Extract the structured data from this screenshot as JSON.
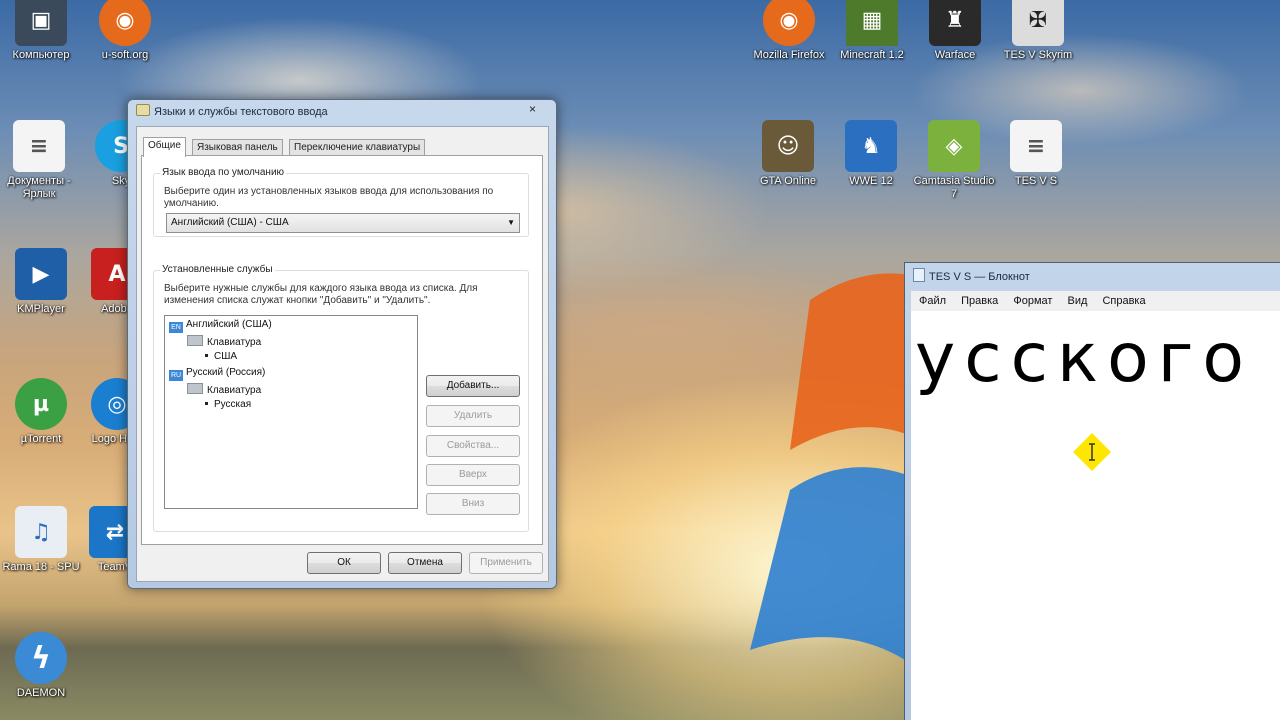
{
  "desktop": {
    "icons": [
      {
        "id": "computer",
        "label": "Компьютер",
        "icon": "computer-icon",
        "color": "#3a4a5a",
        "glyph": "▣"
      },
      {
        "id": "usoft",
        "label": "u-soft.org",
        "icon": "firefox-icon",
        "color": "#e56a1b",
        "glyph": "◉"
      },
      {
        "id": "firefox",
        "label": "Mozilla Firefox",
        "icon": "firefox-icon",
        "color": "#e56a1b",
        "glyph": "◉"
      },
      {
        "id": "minecraft",
        "label": "Minecraft 1.2",
        "icon": "minecraft-icon",
        "color": "#4e7a2c",
        "glyph": "▦"
      },
      {
        "id": "warface",
        "label": "Warface",
        "icon": "warface-icon",
        "color": "#2a2a2a",
        "glyph": "♜"
      },
      {
        "id": "skyrim",
        "label": "TES V Skyrim",
        "icon": "skyrim-icon",
        "color": "#dcdcdc",
        "glyph": "✠"
      },
      {
        "id": "docs",
        "label": "Документы - Ярлык",
        "icon": "document-icon",
        "color": "#f4f4f4",
        "glyph": "≡"
      },
      {
        "id": "skype",
        "label": "Sky",
        "icon": "skype-icon",
        "color": "#1aa0e0",
        "glyph": "S"
      },
      {
        "id": "gta",
        "label": "GTA Online",
        "icon": "gta-icon",
        "color": "#6b5a3a",
        "glyph": "☺"
      },
      {
        "id": "wwe",
        "label": "WWE 12",
        "icon": "wwe-icon",
        "color": "#2a6fc0",
        "glyph": "♞"
      },
      {
        "id": "camtasia",
        "label": "Camtasia Studio 7",
        "icon": "camtasia-icon",
        "color": "#7cb13e",
        "glyph": "◈"
      },
      {
        "id": "tesv",
        "label": "TES V S",
        "icon": "document-icon",
        "color": "#f4f4f4",
        "glyph": "≡"
      },
      {
        "id": "kmp",
        "label": "KMPlayer",
        "icon": "kmplayer-icon",
        "color": "#1f5fa8",
        "glyph": "▶"
      },
      {
        "id": "adobe",
        "label": "Adobe",
        "icon": "adobe-icon",
        "color": "#c8201e",
        "glyph": "A"
      },
      {
        "id": "utorrent",
        "label": "µTorrent",
        "icon": "utorrent-icon",
        "color": "#3ba043",
        "glyph": "µ"
      },
      {
        "id": "logo",
        "label": "Logo Ham",
        "icon": "hamachi-icon",
        "color": "#1a7fd1",
        "glyph": "◎"
      },
      {
        "id": "rama",
        "label": "Rama 18 - SPU",
        "icon": "audio-file-icon",
        "color": "#e9eef4",
        "glyph": "♫"
      },
      {
        "id": "teamviewer",
        "label": "TeamV",
        "icon": "teamviewer-icon",
        "color": "#1b76c8",
        "glyph": "⇄"
      },
      {
        "id": "daemon",
        "label": "DAEMON",
        "icon": "daemon-tools-icon",
        "color": "#3a8ad6",
        "glyph": "ϟ"
      }
    ]
  },
  "dialog": {
    "title": "Языки и службы текстового ввода",
    "close": "×",
    "tabs": [
      "Общие",
      "Языковая панель",
      "Переключение клавиатуры"
    ],
    "default_lang": {
      "group_title": "Язык ввода по умолчанию",
      "description": "Выберите один из установленных языков ввода для использования по умолчанию.",
      "selected": "Английский (США) - США"
    },
    "services": {
      "group_title": "Установленные службы",
      "description": "Выберите нужные службы для каждого языка ввода из списка. Для изменения списка служат кнопки \"Добавить\" и \"Удалить\".",
      "tree": [
        {
          "text": "Английский (США)",
          "flag": "EN"
        },
        {
          "text": "Клавиатура"
        },
        {
          "text": "США"
        },
        {
          "text": "Русский (Россия)",
          "flag": "RU"
        },
        {
          "text": "Клавиатура"
        },
        {
          "text": "Русская"
        }
      ],
      "buttons": {
        "add": "Добавить...",
        "remove": "Удалить",
        "properties": "Свойства...",
        "up": "Вверх",
        "down": "Вниз"
      }
    },
    "footer": {
      "ok": "ОК",
      "cancel": "Отмена",
      "apply": "Применить"
    }
  },
  "notepad": {
    "title": "TES V S — Блокнот",
    "menu": [
      "Файл",
      "Правка",
      "Формат",
      "Вид",
      "Справка"
    ],
    "content": "усского",
    "highlight_color": "#ffe600"
  }
}
